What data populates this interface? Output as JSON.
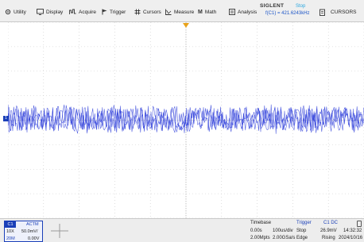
{
  "menu": {
    "utility": "Utility",
    "display": "Display",
    "acquire": "Acquire",
    "trigger": "Trigger",
    "cursors": "Cursors",
    "measure": "Measure",
    "math": "Math",
    "analysis": "Analysis",
    "cursors_right": "CURSORS"
  },
  "header": {
    "brand": "SIGLENT",
    "run_state": "Stop",
    "frequency": "f(C1) = 421.6243kHz"
  },
  "channel": {
    "tag": "C1",
    "mode": "ACTM",
    "coupling_impedance": "10X",
    "volts_per_div": "50.0mV/",
    "bandwidth": "20M",
    "offset": "0.00V",
    "color": "#2a3bd9"
  },
  "timebase": {
    "title": "Timebase",
    "delay": "0.00s",
    "time_per_div": "100us/div",
    "memory_depth": "2.00Mpts",
    "sample_rate": "2.00GSa/s"
  },
  "trigger": {
    "title": "Trigger",
    "source_coupling": "C1 DC",
    "state": "Stop",
    "level": "26.9mV",
    "type": "Edge",
    "slope": "Rising"
  },
  "clock": {
    "time": "14:32:32",
    "date": "2024/10/16"
  }
}
